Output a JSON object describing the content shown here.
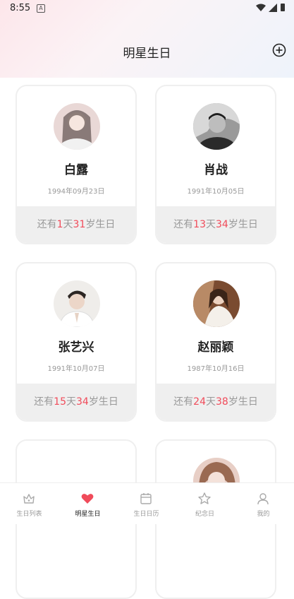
{
  "status_bar": {
    "time": "8:55",
    "notif_icon": "A"
  },
  "header": {
    "title": "明星生日",
    "add_icon": "add-circle-icon"
  },
  "cards": [
    {
      "name": "白露",
      "date": "1994年09月23日",
      "pre": "还有",
      "days": "1",
      "mid": "天",
      "age": "31",
      "post": "岁生日",
      "avatar_tone": "#d9b8b8"
    },
    {
      "name": "肖战",
      "date": "1991年10月05日",
      "pre": "还有",
      "days": "13",
      "mid": "天",
      "age": "34",
      "post": "岁生日",
      "avatar_tone": "#6b6b6b"
    },
    {
      "name": "张艺兴",
      "date": "1991年10月07日",
      "pre": "还有",
      "days": "15",
      "mid": "天",
      "age": "34",
      "post": "岁生日",
      "avatar_tone": "#e6e2de"
    },
    {
      "name": "赵丽颖",
      "date": "1987年10月16日",
      "pre": "还有",
      "days": "24",
      "mid": "天",
      "age": "38",
      "post": "岁生日",
      "avatar_tone": "#8a5a3c"
    },
    {
      "name": "",
      "date": "",
      "pre": "",
      "days": "",
      "mid": "",
      "age": "",
      "post": "",
      "avatar_tone": ""
    },
    {
      "name": "",
      "date": "",
      "pre": "",
      "days": "",
      "mid": "",
      "age": "",
      "post": "",
      "avatar_tone": "#d9b3a8"
    }
  ],
  "tabs": [
    {
      "label": "生日列表",
      "icon": "crown-icon"
    },
    {
      "label": "明星生日",
      "icon": "heart-icon"
    },
    {
      "label": "生日日历",
      "icon": "calendar-icon"
    },
    {
      "label": "纪念日",
      "icon": "star-icon"
    },
    {
      "label": "我的",
      "icon": "person-icon"
    }
  ],
  "colors": {
    "accent": "#f04b5a",
    "muted": "#999999",
    "card_footer": "#efefef"
  }
}
